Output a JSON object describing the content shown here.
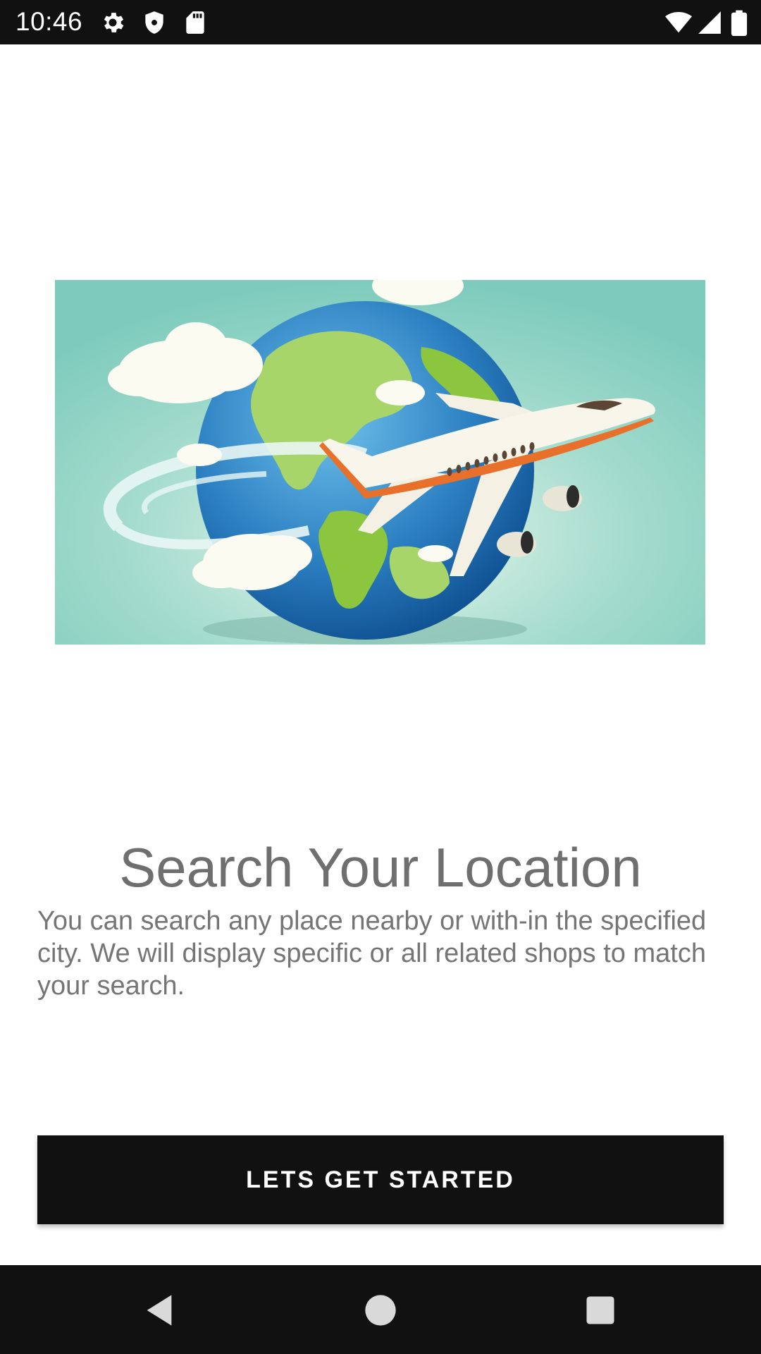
{
  "status_bar": {
    "time": "10:46",
    "icons": [
      "gear-icon",
      "shield-icon",
      "sd-card-icon",
      "wifi-icon",
      "cell-signal-icon",
      "battery-icon"
    ]
  },
  "hero": {
    "icon": "globe-airplane-illustration",
    "colors": {
      "background": "#7ECCBF",
      "ocean": "#1F6FAE",
      "land": "#8CC63F",
      "stripe": "#E8702A"
    }
  },
  "main": {
    "title": "Search Your Location",
    "description": "You can search any place nearby or with-in the specified city. We will display specific or all related shops to match your search.",
    "cta_label": "LETS GET STARTED"
  },
  "nav_bar": {
    "icons": [
      "back-icon",
      "home-icon",
      "recents-icon"
    ]
  }
}
